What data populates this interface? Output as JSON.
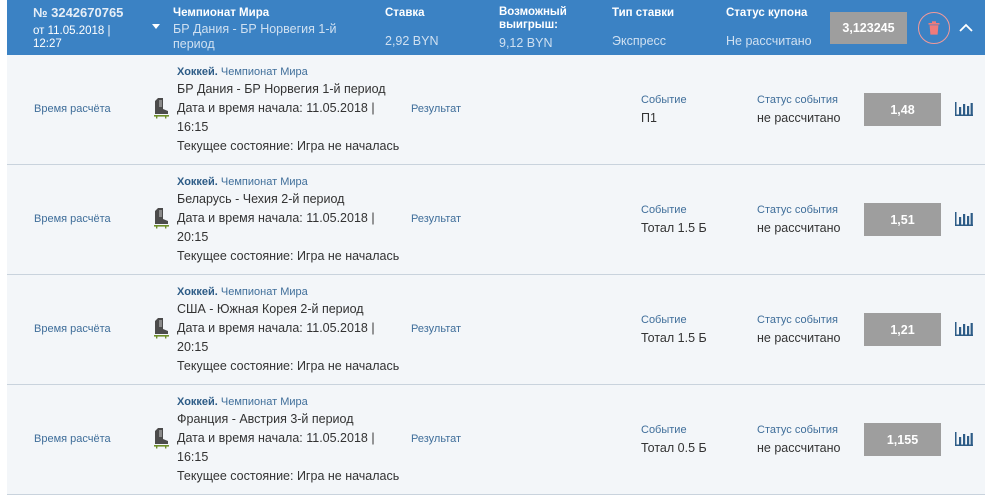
{
  "header": {
    "coupon_number": "№ 3242670765",
    "date_line1": "от 11.05.2018 |",
    "date_line2": "12:27",
    "championship_label": "Чемпионат Мира",
    "championship_value": "БР Дания - БР Норвегия 1-й период",
    "stake_label": "Ставка",
    "stake_value": "2,92 BYN",
    "win_label_line1": "Возможный",
    "win_label_line2": "выигрыш:",
    "win_value": "9,12 BYN",
    "type_label": "Тип ставки",
    "type_value": "Экспресс",
    "status_label": "Статус купона",
    "status_value": "Не рассчитано",
    "total_coef": "3,123245"
  },
  "colors": {
    "header_bg": "#3b82c4",
    "row_bg": "#f3f6f9",
    "coef_bg": "#9e9e9e",
    "delete_accent": "#f29a9a",
    "link_text": "#3f6e9a"
  },
  "rows": [
    {
      "calc_time_label": "Время расчёта",
      "sport_icon": "hockey-skate-icon",
      "sport": "Хоккей.",
      "league": "Чемпионат Мира",
      "match": "БР Дания - БР Норвегия 1-й период",
      "start_line1": "Дата и время начала: 11.05.2018 |",
      "start_line2": "16:15",
      "state": "Текущее состояние: Игра не началась",
      "result_label": "Результат",
      "event_label": "Событие",
      "event_value": "П1",
      "event_status_label": "Статус события",
      "event_status_value": "не рассчитано",
      "coef": "1,48"
    },
    {
      "calc_time_label": "Время расчёта",
      "sport_icon": "hockey-skate-icon",
      "sport": "Хоккей.",
      "league": "Чемпионат Мира",
      "match": "Беларусь - Чехия 2-й период",
      "start_line1": "Дата и время начала: 11.05.2018 |",
      "start_line2": "20:15",
      "state": "Текущее состояние: Игра не началась",
      "result_label": "Результат",
      "event_label": "Событие",
      "event_value": "Тотал 1.5 Б",
      "event_status_label": "Статус события",
      "event_status_value": "не рассчитано",
      "coef": "1,51"
    },
    {
      "calc_time_label": "Время расчёта",
      "sport_icon": "hockey-skate-icon",
      "sport": "Хоккей.",
      "league": "Чемпионат Мира",
      "match": "США - Южная Корея 2-й период",
      "start_line1": "Дата и время начала: 11.05.2018 |",
      "start_line2": "20:15",
      "state": "Текущее состояние: Игра не началась",
      "result_label": "Результат",
      "event_label": "Событие",
      "event_value": "Тотал 1.5 Б",
      "event_status_label": "Статус события",
      "event_status_value": "не рассчитано",
      "coef": "1,21"
    },
    {
      "calc_time_label": "Время расчёта",
      "sport_icon": "hockey-skate-icon",
      "sport": "Хоккей.",
      "league": "Чемпионат Мира",
      "match": "Франция - Австрия 3-й период",
      "start_line1": "Дата и время начала: 11.05.2018 |",
      "start_line2": "16:15",
      "state": "Текущее состояние: Игра не началась",
      "result_label": "Результат",
      "event_label": "Событие",
      "event_value": "Тотал 0.5 Б",
      "event_status_label": "Статус события",
      "event_status_value": "не рассчитано",
      "coef": "1,155"
    }
  ]
}
